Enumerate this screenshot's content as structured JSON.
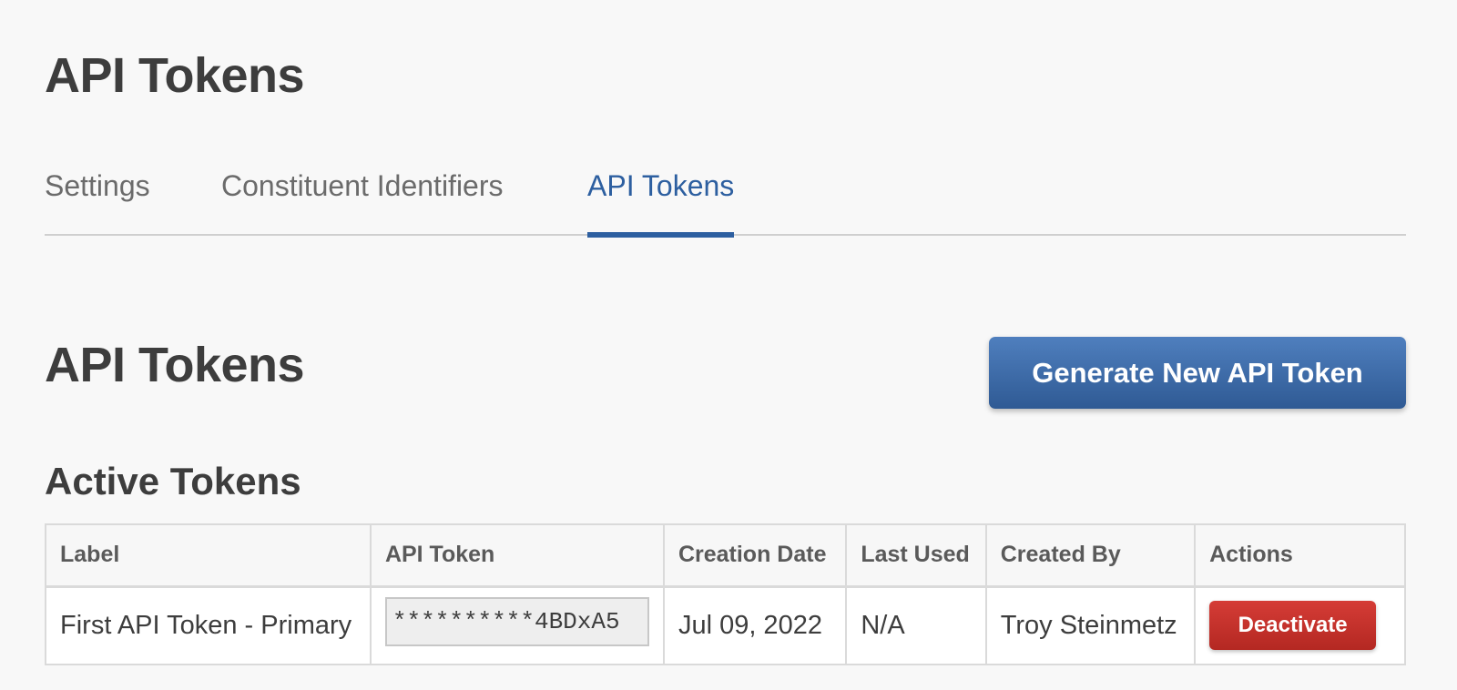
{
  "page": {
    "title": "API Tokens"
  },
  "tabs": [
    {
      "label": "Settings",
      "active": false
    },
    {
      "label": "Constituent Identifiers",
      "active": false
    },
    {
      "label": "API Tokens",
      "active": true
    }
  ],
  "section": {
    "title": "API Tokens",
    "generate_button_label": "Generate New API Token",
    "subsection_title": "Active Tokens"
  },
  "table": {
    "columns": [
      "Label",
      "API Token",
      "Creation Date",
      "Last Used",
      "Created By",
      "Actions"
    ],
    "rows": [
      {
        "label": "First API Token - Primary",
        "token": "**********4BDxA5",
        "creation_date": "Jul 09, 2022",
        "last_used": "N/A",
        "created_by": "Troy Steinmetz",
        "action_label": "Deactivate"
      }
    ]
  },
  "colors": {
    "accent": "#2d5fa0",
    "primary_button": "#3a6aa8",
    "danger_button": "#c0302a",
    "text": "#3d3d3d",
    "background": "#f8f8f8"
  }
}
